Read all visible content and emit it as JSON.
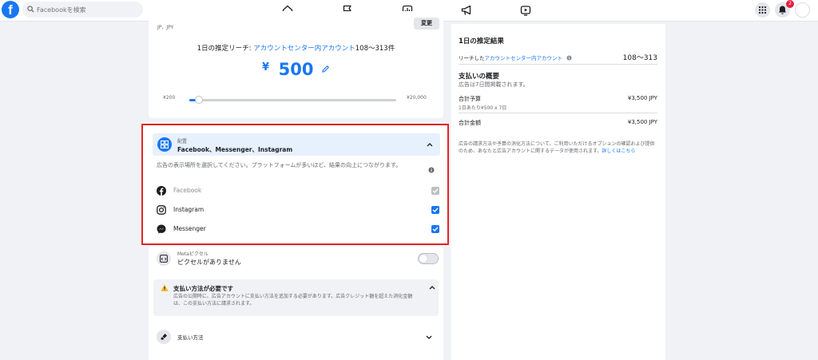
{
  "topbar": {
    "search_placeholder": "Facebookを検索",
    "notification_count": "2",
    "nav_icons": [
      "home-icon",
      "flag-icon",
      "chart-icon",
      "megaphone-icon",
      "video-icon"
    ]
  },
  "budget": {
    "location_value": "JP、JPY",
    "change_button": "変更",
    "reach_label": "1日の推定リーチ: ",
    "reach_link": "アカウントセンター内アカウント",
    "reach_range": "108〜313件",
    "currency_symbol": "¥",
    "amount": "500",
    "slider_min": "¥200",
    "slider_max": "¥20,000",
    "slider_level": 0.04
  },
  "placement": {
    "label": "配置",
    "value": "Facebook、Messenger、Instagram",
    "description": "広告の表示場所を選択してください。プラットフォームが多いほど、結果の向上につながります。",
    "platforms": [
      {
        "name": "Facebook",
        "checked": true,
        "disabled": true
      },
      {
        "name": "Instagram",
        "checked": true,
        "disabled": false
      },
      {
        "name": "Messenger",
        "checked": true,
        "disabled": false
      }
    ]
  },
  "pixel": {
    "label": "Metaピクセル",
    "value": "ピクセルがありません",
    "enabled": false
  },
  "payment_warning": {
    "title": "支払い方法が必要です",
    "body": "広告の公開時に、広告アカウントに支払い方法を追加する必要があります。広告クレジット額を超えた消化金額は、この支払い方法に請求されます。"
  },
  "payment_method": {
    "label": "支払い方法"
  },
  "summary": {
    "results_title": "1日の推定結果",
    "reach_label": "リーチした",
    "reach_link": "アカウントセンター内アカウント",
    "reach_value": "108〜313",
    "payment_title": "支払いの概要",
    "duration_text": "広告は7日間掲載されます。",
    "total_budget_label": "合計予算",
    "total_budget_value": "¥3,500 JPY",
    "daily_breakdown": "1日あたり¥500 x 7日",
    "total_amount_label": "合計金額",
    "total_amount_value": "¥3,500 JPY",
    "disclaimer": "広告の請求方法や予算の消化方法について、ご利用いただけるオプションの確認および提供のため、あなたと広告アカウントに関するデータが使用されます。",
    "learn_more": "詳しくはこちら"
  },
  "colors": {
    "accent": "#1877f2",
    "highlight_border": "#e02424",
    "warning": "#f7b928"
  }
}
